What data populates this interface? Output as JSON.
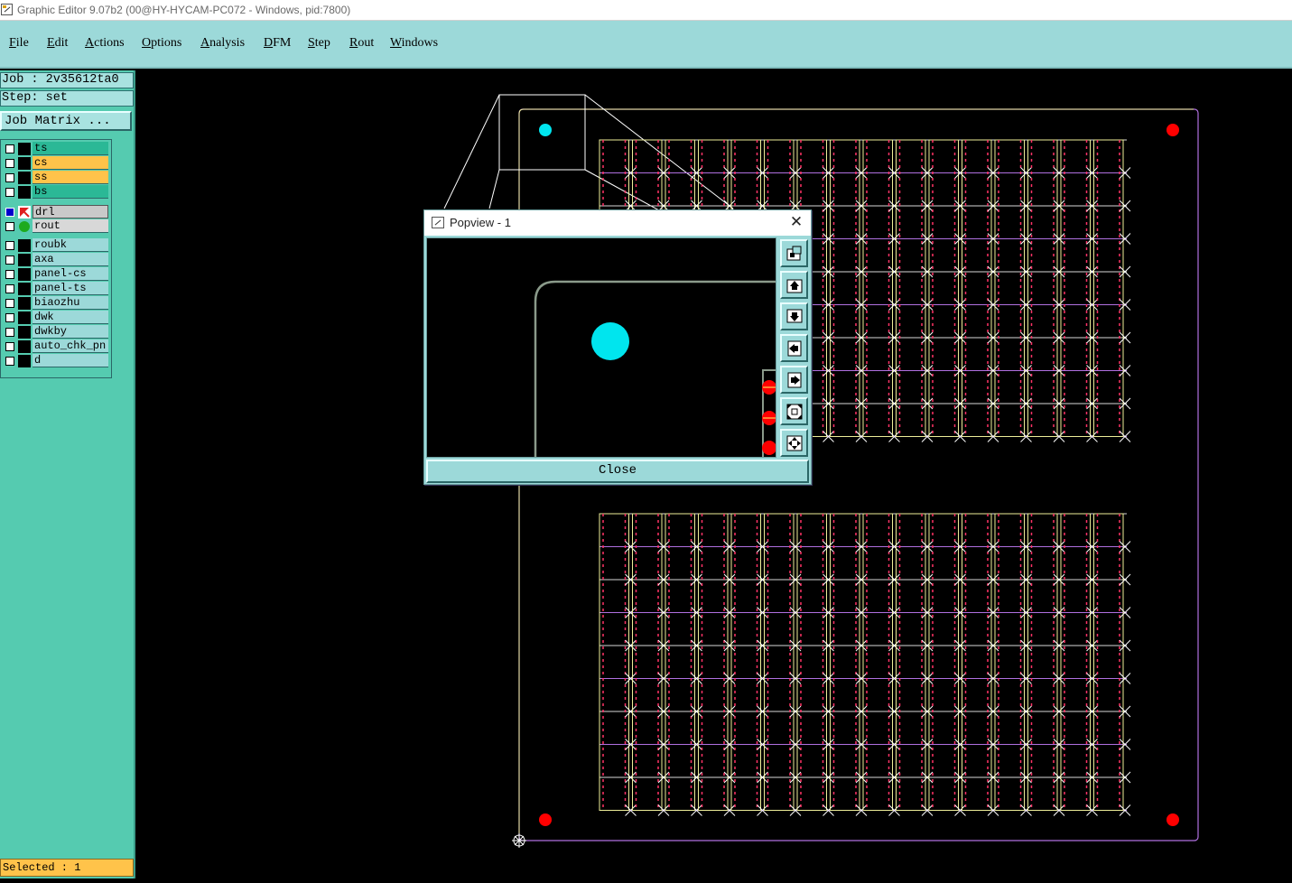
{
  "window": {
    "title": "Graphic Editor 9.07b2 (00@HY-HYCAM-PC072 - Windows, pid:7800)"
  },
  "menu": [
    {
      "label_ul": "F",
      "label_rest": "ile"
    },
    {
      "label_ul": "E",
      "label_rest": "dit"
    },
    {
      "label_ul": "A",
      "label_rest": "ctions"
    },
    {
      "label_ul": "O",
      "label_rest": "ptions"
    },
    {
      "label_ul": "A",
      "label_rest": "nalysis"
    },
    {
      "label_ul": "D",
      "label_rest": "FM"
    },
    {
      "label_ul": "S",
      "label_rest": "tep"
    },
    {
      "label_ul": "R",
      "label_rest": "out"
    },
    {
      "label_ul": "W",
      "label_rest": "indows"
    }
  ],
  "left_panel": {
    "job_line": "Job : 2v35612ta0",
    "step_line": "Step: set",
    "job_matrix_button": "Job Matrix ...",
    "layers": [
      {
        "name": "ts",
        "color": "#2bb896"
      },
      {
        "name": "cs",
        "color": "#ffc34a"
      },
      {
        "name": "ss",
        "color": "#ffc34a"
      },
      {
        "name": "bs",
        "color": "#2bb896"
      },
      {
        "name": "drl",
        "color": "#c9c9c9",
        "state": "work"
      },
      {
        "name": "rout",
        "color": "#d8d8d8",
        "state": "display"
      },
      {
        "name": "roubk",
        "color": "#9cd9d9"
      },
      {
        "name": "axa",
        "color": "#9cd9d9"
      },
      {
        "name": "panel-cs",
        "color": "#9cd9d9"
      },
      {
        "name": "panel-ts",
        "color": "#9cd9d9"
      },
      {
        "name": "biaozhu",
        "color": "#9cd9d9"
      },
      {
        "name": "dwk",
        "color": "#9cd9d9"
      },
      {
        "name": "dwkby",
        "color": "#9cd9d9"
      },
      {
        "name": "auto_chk_pn",
        "color": "#9cd9d9"
      },
      {
        "name": "d",
        "color": "#9cd9d9"
      }
    ],
    "selected_status": "Selected : 1"
  },
  "popview": {
    "title": "Popview - 1",
    "close_label": "Close",
    "tools": [
      "zoom-window-icon",
      "pan-up-icon",
      "pan-down-icon",
      "pan-left-icon",
      "pan-right-icon",
      "zoom-in-icon",
      "zoom-out-icon"
    ]
  },
  "colors": {
    "menu_bg": "#9cd9d9",
    "panel_bg": "#55cbb0",
    "fiducial_cyan": "#00e5ee",
    "target_red": "#ff0000",
    "grid_yellow": "#eeee99",
    "grid_purple": "#b070e0",
    "grid_pink": "#ff3366"
  }
}
